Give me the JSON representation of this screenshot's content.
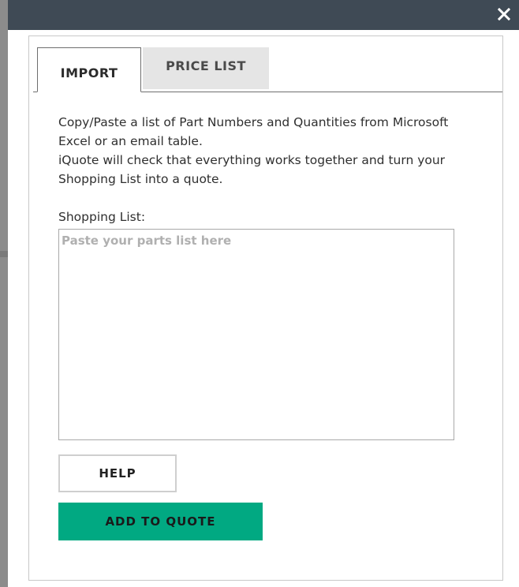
{
  "window": {
    "close_icon": "close-icon"
  },
  "tabs": [
    {
      "label": "IMPORT",
      "active": true
    },
    {
      "label": "PRICE LIST",
      "active": false
    }
  ],
  "description": {
    "line1": "Copy/Paste a list of Part Numbers and Quantities from Microsoft Excel or an email table.",
    "line2": "iQuote will check that everything works together and turn your Shopping List into a quote."
  },
  "shopping_list": {
    "label": "Shopping List:",
    "placeholder": "Paste your parts list here",
    "value": ""
  },
  "buttons": {
    "help": "HELP",
    "add_to_quote": "ADD TO QUOTE"
  },
  "colors": {
    "titlebar": "#3f4a55",
    "accent": "#01a982"
  }
}
